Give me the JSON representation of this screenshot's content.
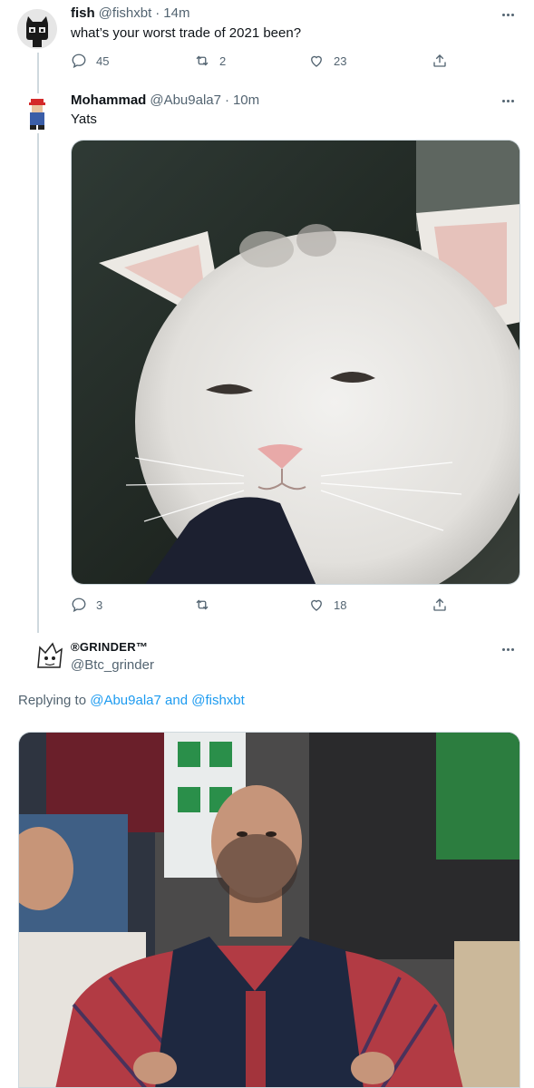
{
  "tweets": [
    {
      "name": "fish",
      "handle": "@fishxbt",
      "separator": "·",
      "time": "14m",
      "text": "what’s your worst trade of 2021 been?",
      "replies": "45",
      "retweets": "2",
      "likes": "23"
    },
    {
      "name": "Mohammad",
      "handle": "@Abu9ala7",
      "separator": "·",
      "time": "10m",
      "text": "Yats",
      "replies": "3",
      "retweets": "",
      "likes": "18"
    },
    {
      "name": "®GRINDER™",
      "handle": "@Btc_grinder"
    }
  ],
  "replying_to": {
    "prefix": "Replying to",
    "user1": "@Abu9ala7",
    "conjunction": "and",
    "user2": "@fishxbt"
  },
  "colors": {
    "accent": "#1d9bf0",
    "secondary_text": "#536471",
    "thread_line": "#cfd9de"
  },
  "icons": [
    "reply-icon",
    "retweet-icon",
    "like-icon",
    "share-icon",
    "more-icon"
  ]
}
